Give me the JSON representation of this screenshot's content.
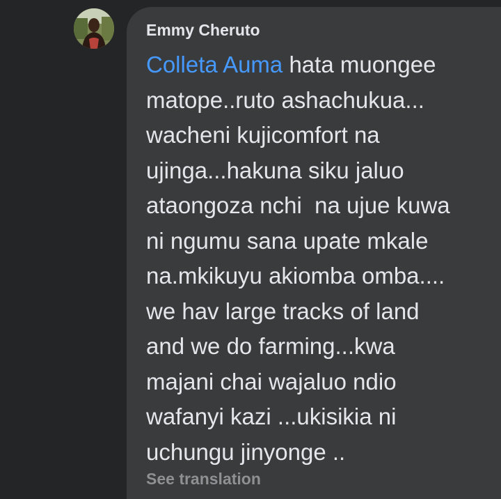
{
  "comment": {
    "author": "Emmy Cheruto",
    "avatar_icon": "profile-photo",
    "mention": "Colleta Auma",
    "first_line_rest": " hata muongee",
    "lines": [
      "matope..ruto ashachukua...",
      "wacheni kujicomfort na",
      "ujinga...hakuna siku jaluo",
      "ataongoza nchi  na ujue kuwa",
      "ni ngumu sana upate mkale",
      "na.mkikuyu akiomba omba....",
      "we hav large tracks of land",
      "and we do farming...kwa",
      "majani chai wajaluo ndio",
      "wafanyi kazi ...ukisikia ni",
      "uchungu jinyonge .."
    ],
    "see_translation": "See translation"
  },
  "colors": {
    "background": "#242526",
    "bubble": "#3a3b3c",
    "text": "#e4e6eb",
    "mention": "#4599ff",
    "secondary_text": "#8e9094"
  }
}
